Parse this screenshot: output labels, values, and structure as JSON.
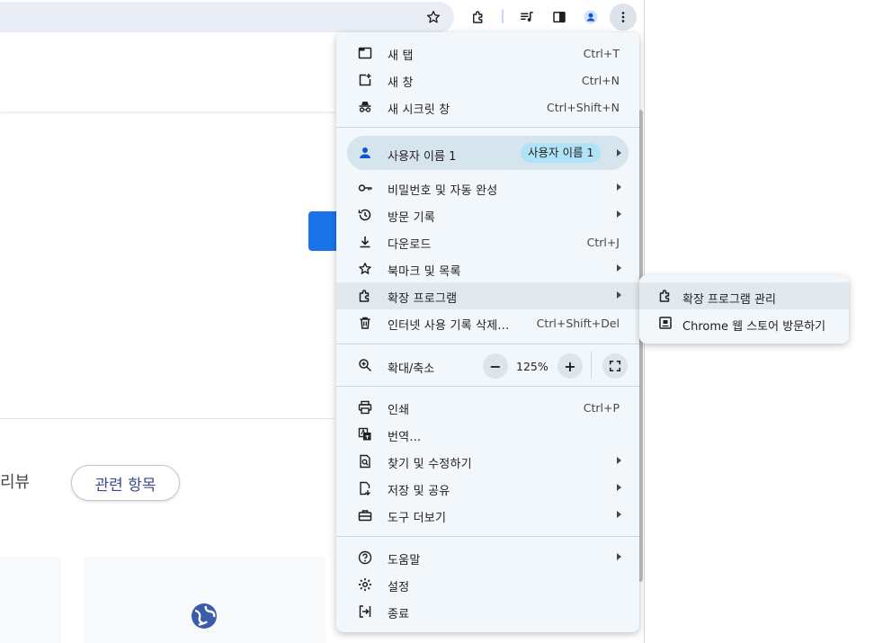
{
  "toolbar": {
    "icons": [
      "star-icon",
      "extensions-icon",
      "media-icon",
      "side-panel-icon",
      "profile-icon",
      "more-icon"
    ]
  },
  "page": {
    "review_text": "리뷰",
    "related_chip": "관련 항목"
  },
  "menu": {
    "new_tab": {
      "label": "새 탭",
      "shortcut": "Ctrl+T"
    },
    "new_window": {
      "label": "새 창",
      "shortcut": "Ctrl+N"
    },
    "incognito": {
      "label": "새 시크릿 창",
      "shortcut": "Ctrl+Shift+N"
    },
    "profile": {
      "label": "사용자 이름 1",
      "badge": "사용자 이름 1"
    },
    "passwords": {
      "label": "비밀번호 및 자동 완성"
    },
    "history": {
      "label": "방문 기록"
    },
    "downloads": {
      "label": "다운로드",
      "shortcut": "Ctrl+J"
    },
    "bookmarks": {
      "label": "북마크 및 목록"
    },
    "extensions": {
      "label": "확장 프로그램"
    },
    "clear_data": {
      "label": "인터넷 사용 기록 삭제...",
      "shortcut": "Ctrl+Shift+Del"
    },
    "zoom": {
      "label": "확대/축소",
      "minus": "−",
      "value": "125%",
      "plus": "+"
    },
    "print": {
      "label": "인쇄",
      "shortcut": "Ctrl+P"
    },
    "translate": {
      "label": "번역..."
    },
    "find": {
      "label": "찾기 및 수정하기"
    },
    "save_share": {
      "label": "저장 및 공유"
    },
    "more_tools": {
      "label": "도구 더보기"
    },
    "help": {
      "label": "도움말"
    },
    "settings": {
      "label": "설정"
    },
    "exit": {
      "label": "종료"
    }
  },
  "submenu": {
    "manage": {
      "label": "확장 프로그램 관리"
    },
    "webstore": {
      "label": "Chrome 웹 스토어 방문하기"
    }
  },
  "colors": {
    "menu_bg": "#f1f7fa",
    "highlight": "#e2e9ee",
    "profile_bg": "#d6e4ed",
    "badge_bg": "#b0e3f7",
    "accent_blue": "#1a73e8"
  }
}
